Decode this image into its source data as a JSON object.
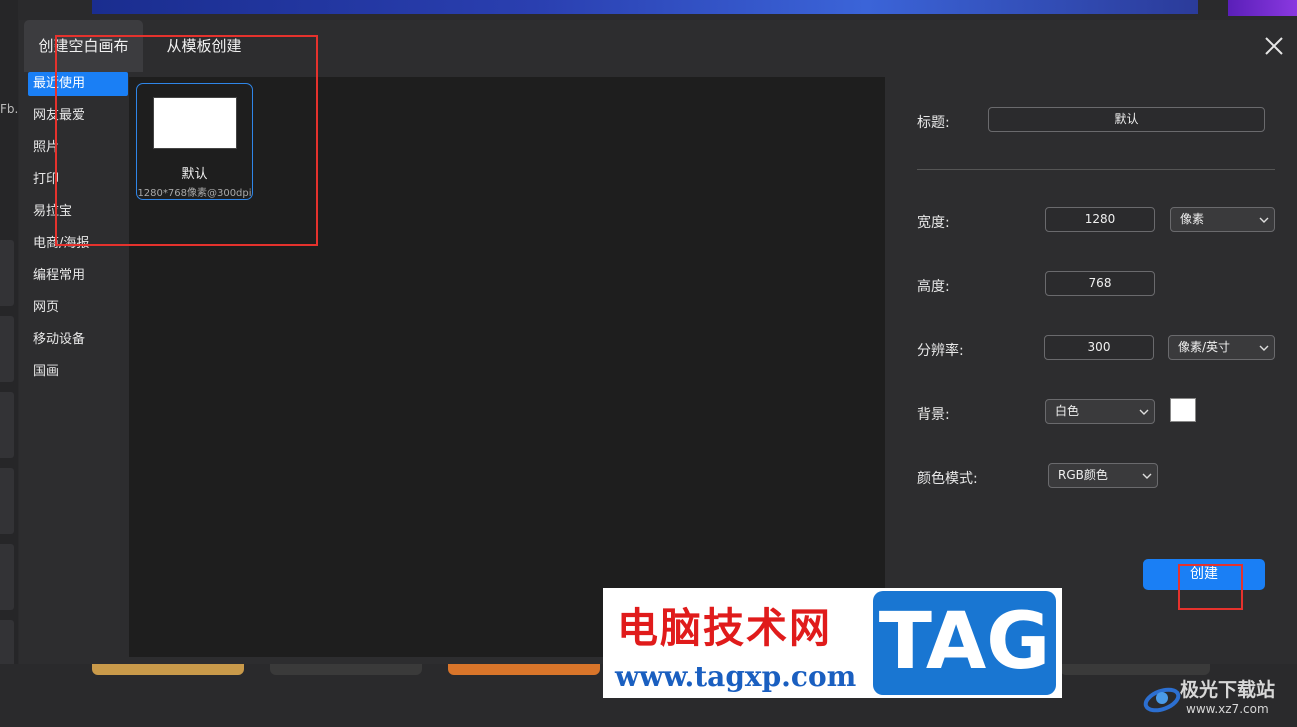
{
  "background": {
    "left_text": "Fb.."
  },
  "dialog": {
    "tabs": [
      {
        "label": "创建空白画布"
      },
      {
        "label": "从模板创建"
      }
    ],
    "categories": [
      {
        "label": "最近使用"
      },
      {
        "label": "网友最爱"
      },
      {
        "label": "照片"
      },
      {
        "label": "打印"
      },
      {
        "label": "易拉宝"
      },
      {
        "label": "电商/海报"
      },
      {
        "label": "编程常用"
      },
      {
        "label": "网页"
      },
      {
        "label": "移动设备"
      },
      {
        "label": "国画"
      }
    ],
    "selected_category": "最近使用",
    "template": {
      "name": "默认",
      "size": "1280*768像素@300dpi"
    },
    "settings": {
      "title_label": "标题:",
      "title_value": "默认",
      "width_label": "宽度:",
      "width_value": "1280",
      "width_unit": "像素",
      "height_label": "高度:",
      "height_value": "768",
      "resolution_label": "分辨率:",
      "resolution_value": "300",
      "resolution_unit": "像素/英寸",
      "background_label": "背景:",
      "background_value": "白色",
      "background_swatch": "#ffffff",
      "color_mode_label": "颜色模式:",
      "color_mode_value": "RGB颜色"
    },
    "create_label": "创建"
  },
  "colors": {
    "accent": "#1a7ff5",
    "annotation": "#e5322d"
  },
  "watermark": {
    "cn": "电脑技术网",
    "url": "www.tagxp.com",
    "tag": "TAG"
  },
  "corner_logo": {
    "cn": "极光下载站",
    "url": "www.xz7.com"
  }
}
